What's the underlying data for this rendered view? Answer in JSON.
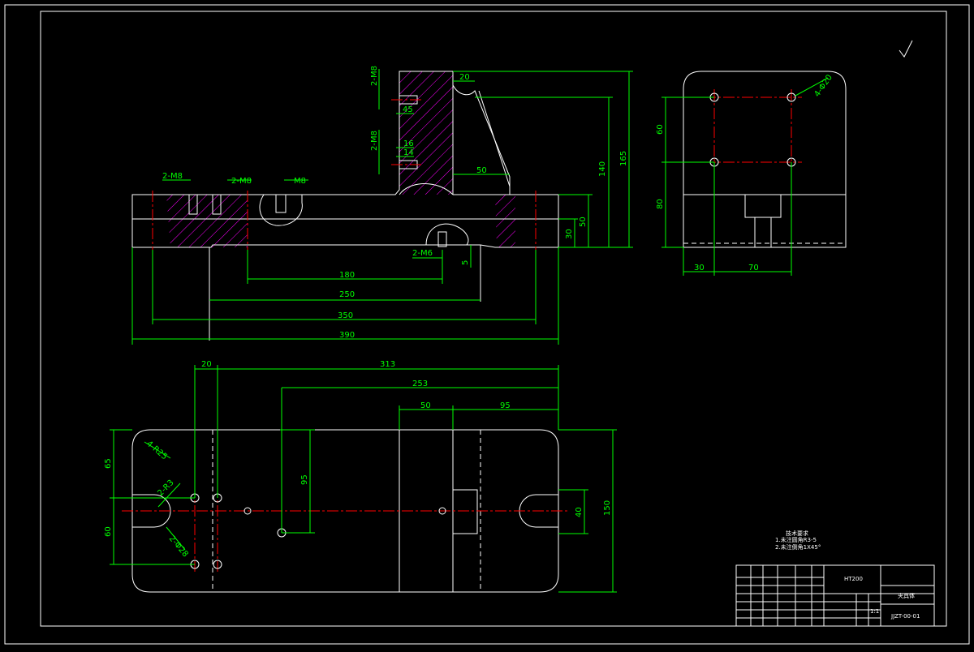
{
  "colors": {
    "background": "#000000",
    "outline": "#ffffff",
    "dimension": "#00ff00",
    "centerline": "#ff0000",
    "hatch": "#ff00ff"
  },
  "front_view": {
    "dims": {
      "d20": "20",
      "d45": "45",
      "d16": "16",
      "d14": "14",
      "d50_top": "50",
      "d140": "140",
      "d165": "165",
      "d50_side": "50",
      "d30": "30",
      "d5": "5",
      "d180": "180",
      "d250": "250",
      "d350": "350",
      "d390": "390"
    },
    "threads": {
      "t2m8_a": "2-M8",
      "t2m8_b": "2-M8",
      "t2m8_c": "2-M8",
      "t2m8_d": "2-M8",
      "tm8": "M8",
      "t2m6": "2-M6"
    }
  },
  "side_view": {
    "dims": {
      "d60": "60",
      "d80": "80",
      "d30": "30",
      "d70": "70"
    },
    "holes_label": "4-Φ20"
  },
  "top_view": {
    "dims": {
      "d20": "20",
      "d313": "313",
      "d253": "253",
      "d50": "50",
      "d95_h": "95",
      "d95_v": "95",
      "d65": "65",
      "d60": "60",
      "d40": "40",
      "d150": "150"
    },
    "holes": {
      "r1": "4-R25",
      "r2": "2-R3",
      "r3": "2-Φ28"
    }
  },
  "notes": {
    "title": "技术要求",
    "line1": "1.未注圆角R3-5",
    "line2": "2.未注倒角1X45°"
  },
  "title_block": {
    "material": "HT200",
    "name": "夹具体",
    "drawing_no": "JJZT-00-01",
    "scale": "1:1"
  }
}
